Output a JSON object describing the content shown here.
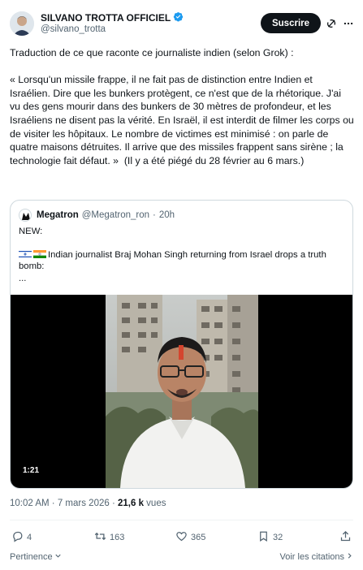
{
  "author": {
    "display_name": "SILVANO TROTTA OFFICIEL",
    "handle": "@silvano_trotta",
    "verified_icon": "verified-badge-icon"
  },
  "header": {
    "follow_label": "Suscrire",
    "grok_icon": "grok-icon",
    "more_icon": "more-icon"
  },
  "tweet": {
    "text": "Traduction de ce que raconte ce journaliste indien (selon Grok) :\n\n« Lorsqu'un missile frappe, il ne fait pas de distinction entre Indien et Israélien. Dire que les bunkers protègent, ce n'est que de la rhétorique. J'ai vu des gens mourir dans des bunkers de 30 mètres de profondeur, et les Israéliens ne disent pas la vérité. En Israël, il est interdit de filmer les corps ou de visiter les hôpitaux. Le nombre de victimes est minimisé : on parle de quatre maisons détruites. Il arrive que des missiles frappent sans sirène ; la technologie fait défaut. »  (Il y a été piégé du 28 février au 6 mars.)"
  },
  "quote": {
    "display_name": "Megatron",
    "handle": "@Megatron_ron",
    "separator": "·",
    "time": "20h",
    "line1": "NEW:",
    "line2": "Indian journalist Braj Mohan Singh returning from Israel drops a truth bomb:",
    "line3": "...",
    "flags": [
      "israel-flag",
      "india-flag"
    ],
    "video_duration": "1:21"
  },
  "meta": {
    "time": "10:02 AM",
    "dot": " · ",
    "date": "7 mars 2026",
    "dot2": " · ",
    "views_count": "21,6 k",
    "views_label": " vues"
  },
  "actions": {
    "replies": "4",
    "reposts": "163",
    "likes": "365",
    "bookmarks": "32"
  },
  "footer": {
    "sort_label": "Pertinence",
    "quotes_label": "Voir les citations"
  },
  "colors": {
    "accent": "#1d9bf0",
    "text": "#0f1419",
    "muted": "#536471",
    "border": "#cfd9de"
  }
}
